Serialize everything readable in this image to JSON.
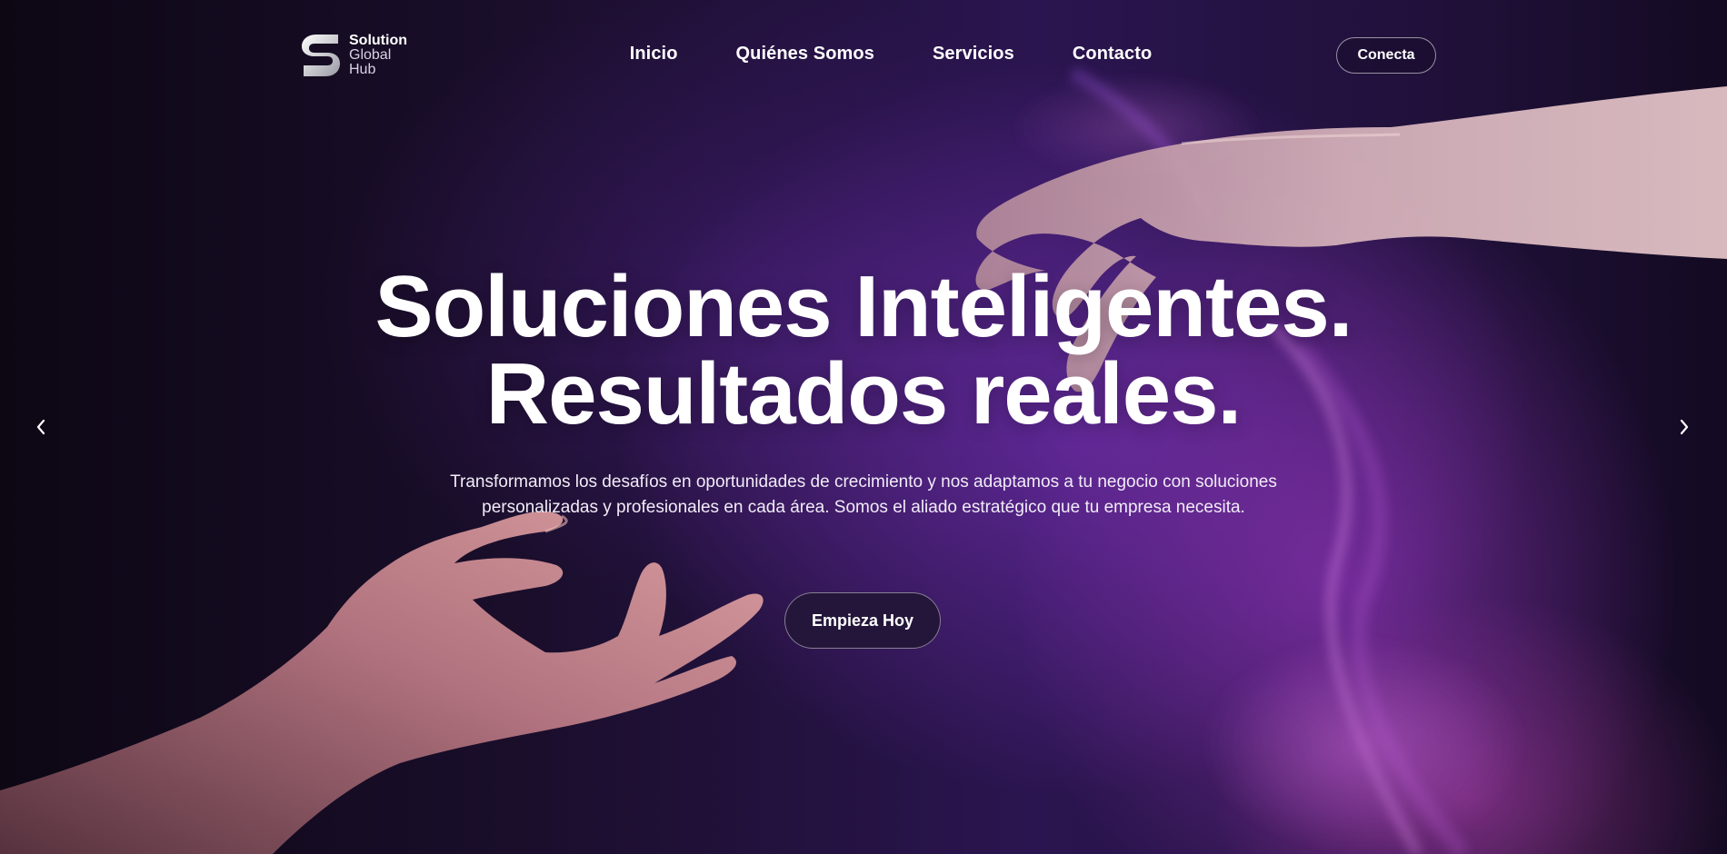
{
  "brand": {
    "name_line1": "Solution",
    "name_line2": "Global",
    "name_line3": "Hub",
    "logo_icon": "s-logo-icon"
  },
  "nav": {
    "items": [
      {
        "label": "Inicio"
      },
      {
        "label": "Quiénes Somos"
      },
      {
        "label": "Servicios"
      },
      {
        "label": "Contacto"
      }
    ]
  },
  "header": {
    "connect_label": "Conecta"
  },
  "hero": {
    "headline_line1": "Soluciones Inteligentes.",
    "headline_line2": "Resultados reales.",
    "subtitle_line1": "Transformamos los desafíos en oportunidades de crecimiento y nos adaptamos a tu negocio con soluciones",
    "subtitle_line2": "personalizadas y profesionales en cada área. Somos el aliado estratégico que tu empresa necesita.",
    "cta_label": "Empieza Hoy",
    "background_image": "two-reaching-hands-purple-smoke",
    "prev_icon": "chevron-left-icon",
    "next_icon": "chevron-right-icon"
  },
  "colors": {
    "background_dark": "#12091f",
    "accent_purple": "#6a2fb0",
    "glow_magenta": "#c046aa",
    "button_fill": "#24163a",
    "text": "#ffffff"
  }
}
